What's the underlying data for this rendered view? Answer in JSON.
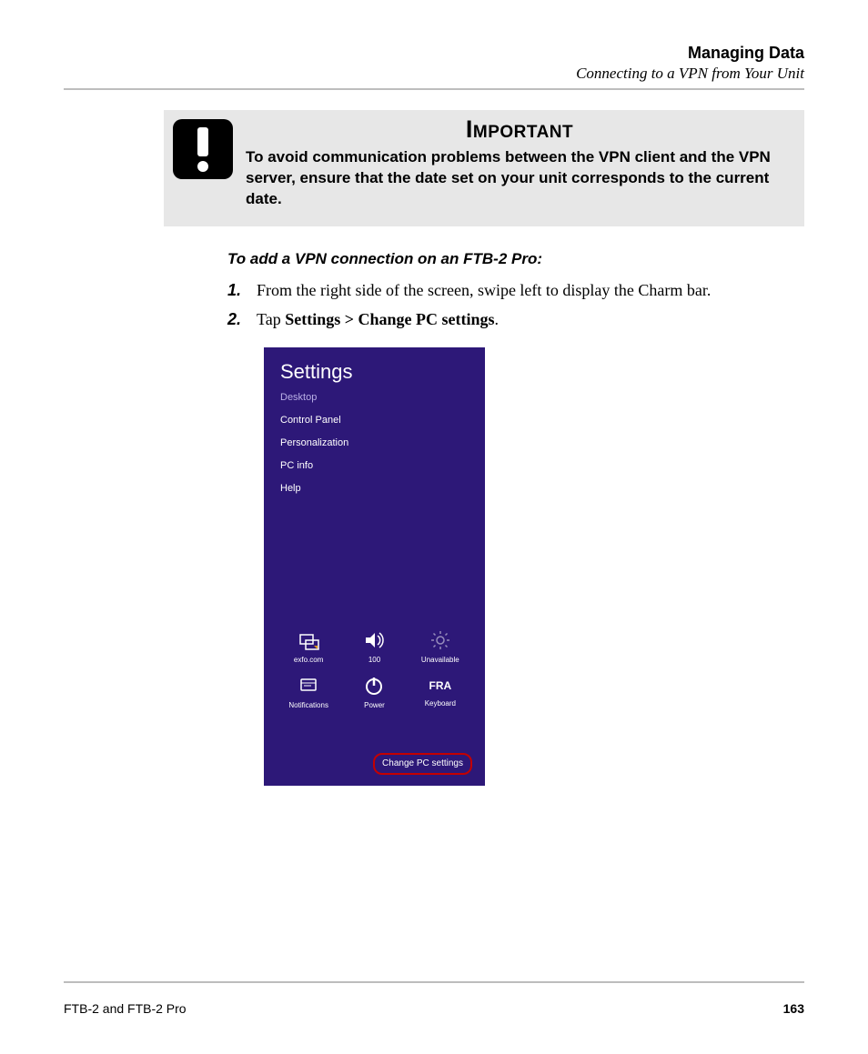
{
  "header": {
    "title": "Managing Data",
    "subtitle": "Connecting to a VPN from Your Unit"
  },
  "callout": {
    "title": "Important",
    "text": "To avoid communication problems between the VPN client and the VPN server, ensure that the date set on your unit corresponds to the current date."
  },
  "procedure": {
    "title": "To add a VPN connection on an FTB-2 Pro:",
    "steps": {
      "s1": {
        "num": "1.",
        "text": "From the right side of the screen, swipe left to display the Charm bar."
      },
      "s2": {
        "num": "2.",
        "pre": "Tap ",
        "bold": "Settings > Change PC settings",
        "post": "."
      }
    }
  },
  "charm": {
    "title": "Settings",
    "links": {
      "desktop": "Desktop",
      "control_panel": "Control Panel",
      "personalization": "Personalization",
      "pc_info": "PC info",
      "help": "Help"
    },
    "tiles": {
      "network": "exfo.com",
      "volume": "100",
      "brightness": "Unavailable",
      "notifications": "Notifications",
      "power": "Power",
      "keyboard_lang": "FRA",
      "keyboard_label": "Keyboard"
    },
    "change_pc": "Change PC settings"
  },
  "footer": {
    "product": "FTB-2 and FTB-2 Pro",
    "page": "163"
  }
}
